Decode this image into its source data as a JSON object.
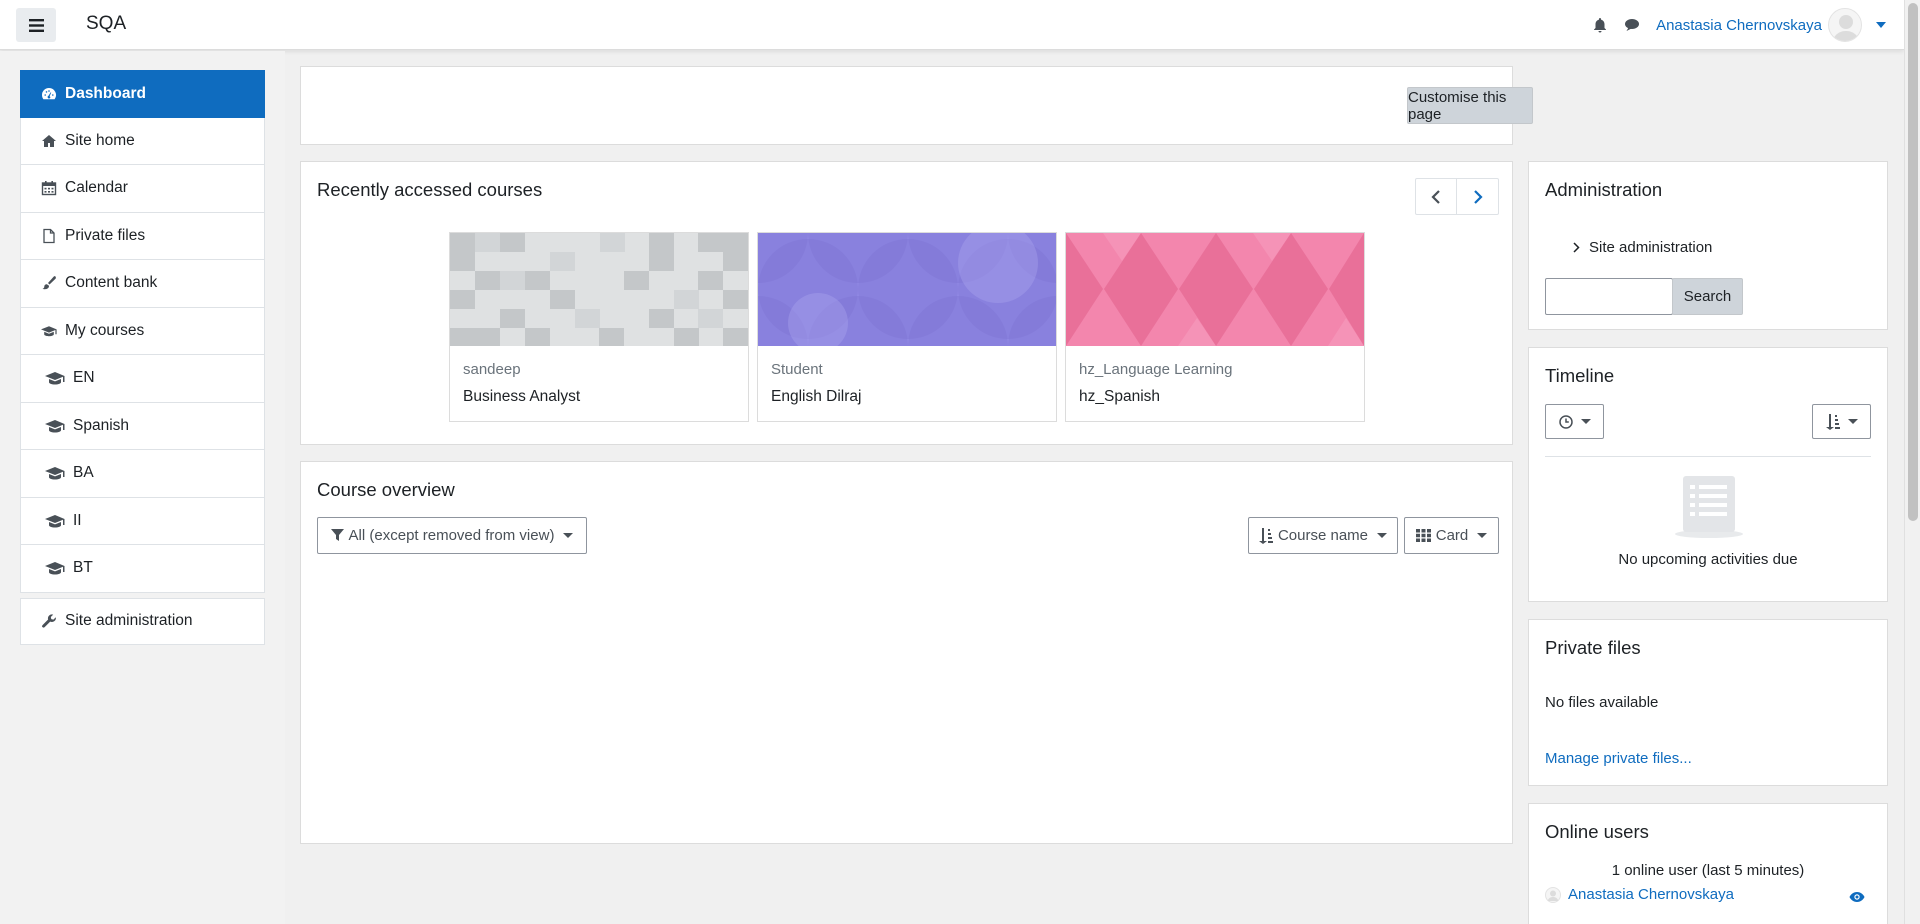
{
  "navbar": {
    "site_name": "SQA",
    "user_name": "Anastasia Chernovskaya",
    "icons": [
      "menu-icon",
      "bell-icon",
      "chat-icon",
      "avatar",
      "caret-down-icon"
    ]
  },
  "drawer": {
    "items": [
      {
        "label": "Dashboard",
        "icon": "dashboard-icon",
        "active": true
      },
      {
        "label": "Site home",
        "icon": "home-icon"
      },
      {
        "label": "Calendar",
        "icon": "calendar-icon"
      },
      {
        "label": "Private files",
        "icon": "file-icon"
      },
      {
        "label": "Content bank",
        "icon": "paintbrush-icon"
      },
      {
        "label": "My courses",
        "icon": "graduation-cap-icon"
      },
      {
        "label": "EN",
        "icon": "graduation-cap-icon"
      },
      {
        "label": "Spanish",
        "icon": "graduation-cap-icon"
      },
      {
        "label": "BA",
        "icon": "graduation-cap-icon"
      },
      {
        "label": "II",
        "icon": "graduation-cap-icon"
      },
      {
        "label": "BT",
        "icon": "graduation-cap-icon"
      }
    ],
    "admin_label": "Site administration"
  },
  "header": {
    "customise_label": "Customise this page"
  },
  "recent": {
    "title": "Recently accessed courses",
    "courses": [
      {
        "category": "sandeep",
        "name": "Business Analyst"
      },
      {
        "category": "Student",
        "name": "English Dilraj"
      },
      {
        "category": "hz_Language Learning",
        "name": "hz_Spanish"
      }
    ]
  },
  "overview": {
    "title": "Course overview",
    "filter_label": "All (except removed from view)",
    "sort_label": "Course name",
    "view_label": "Card"
  },
  "administration": {
    "title": "Administration",
    "site_admin_label": "Site administration",
    "search_button": "Search",
    "search_value": ""
  },
  "timeline": {
    "title": "Timeline",
    "empty_text": "No upcoming activities due"
  },
  "private_files": {
    "title": "Private files",
    "empty_text": "No files available",
    "manage_link": "Manage private files..."
  },
  "online_users": {
    "title": "Online users",
    "summary": "1 online user (last 5 minutes)",
    "user": "Anastasia Chernovskaya"
  },
  "colors": {
    "primary": "#0f6cbf",
    "course_1": "#dfe1e2",
    "course_2": "#968ee8",
    "course_3": "#f386ad"
  }
}
